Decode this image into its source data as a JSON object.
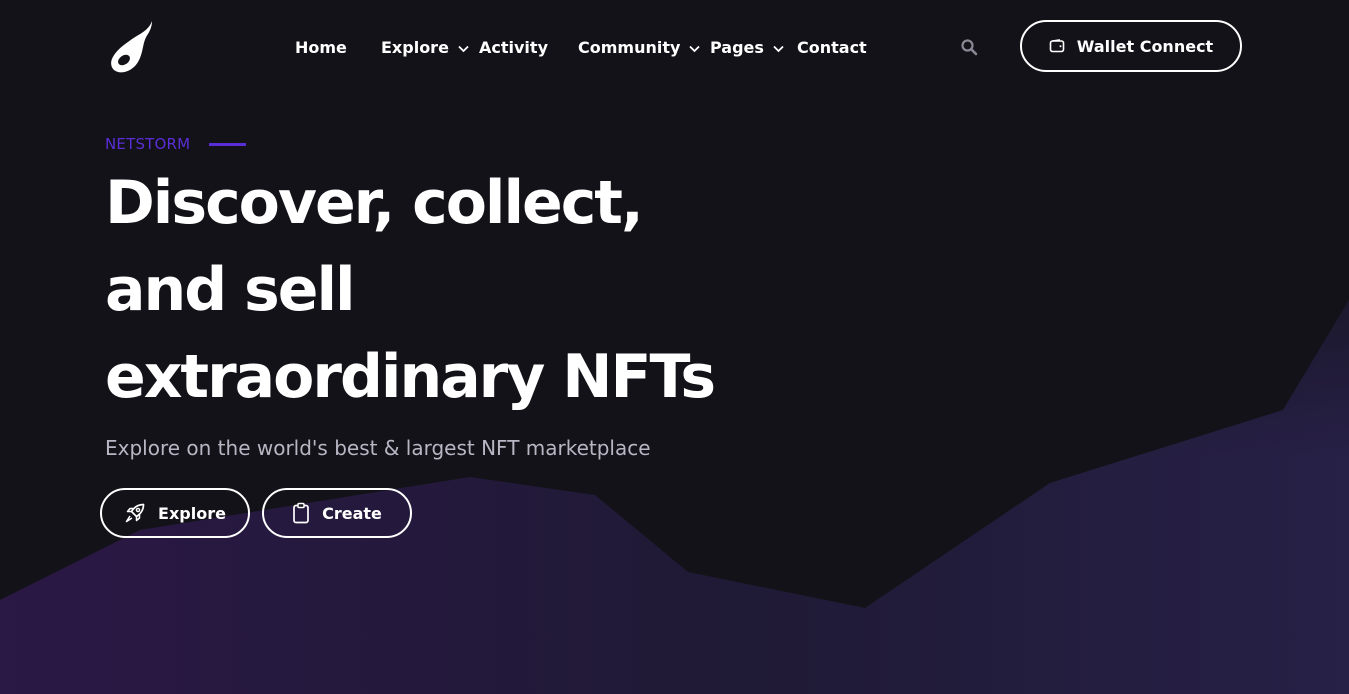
{
  "brand": {
    "logo_icon": "flame-drop-logo-icon"
  },
  "nav": {
    "items": [
      {
        "label": "Home",
        "has_dropdown": false
      },
      {
        "label": "Explore",
        "has_dropdown": true
      },
      {
        "label": "Activity",
        "has_dropdown": false
      },
      {
        "label": "Community",
        "has_dropdown": true
      },
      {
        "label": "Pages",
        "has_dropdown": true
      },
      {
        "label": "Contact",
        "has_dropdown": false
      }
    ],
    "search_icon": "search-icon"
  },
  "header": {
    "wallet_label": "Wallet Connect",
    "wallet_icon": "wallet-icon"
  },
  "hero": {
    "eyebrow": "NETSTORM",
    "title_lines": [
      "Discover, collect,",
      "and sell",
      "extraordinary NFTs"
    ],
    "subtitle": "Explore on the world's best & largest NFT marketplace",
    "buttons": [
      {
        "label": "Explore",
        "icon": "rocket-icon"
      },
      {
        "label": "Create",
        "icon": "clipboard-icon"
      }
    ]
  },
  "colors": {
    "background": "#131218",
    "accent": "#5a2ed6",
    "text": "#ffffff",
    "subtext": "#b9b6c4",
    "mountain_left": "#2a1845",
    "mountain_right": "#261f42"
  }
}
